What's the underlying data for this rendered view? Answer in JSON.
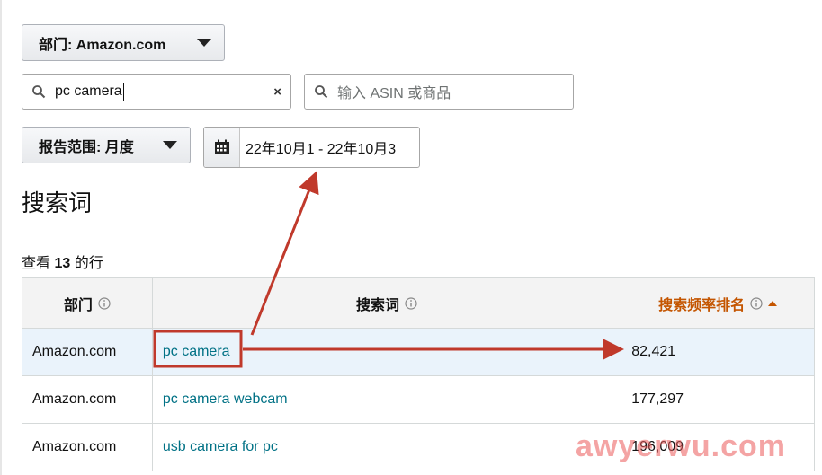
{
  "filters": {
    "department_label": "部门: Amazon.com",
    "search_value": "pc camera",
    "asin_placeholder": "输入 ASIN 或商品",
    "report_range_label": "报告范围: 月度",
    "date_range": "22年10月1 - 22年10月3"
  },
  "section_title": "搜索词",
  "row_count": {
    "prefix": "查看",
    "count": "13",
    "suffix": "的行"
  },
  "table": {
    "headers": [
      "部门",
      "搜索词",
      "搜索频率排名"
    ],
    "rows": [
      {
        "department": "Amazon.com",
        "term": "pc camera",
        "rank": "82,421"
      },
      {
        "department": "Amazon.com",
        "term": "pc camera webcam",
        "rank": "177,297"
      },
      {
        "department": "Amazon.com",
        "term": "usb camera for pc",
        "rank": "196,009"
      }
    ]
  },
  "annotation": {
    "color": "#c0392b"
  },
  "watermark": "awyerwu.com",
  "colors": {
    "link": "#007185",
    "sorted_header": "#c45500",
    "highlight_row": "#eaf3fb"
  }
}
